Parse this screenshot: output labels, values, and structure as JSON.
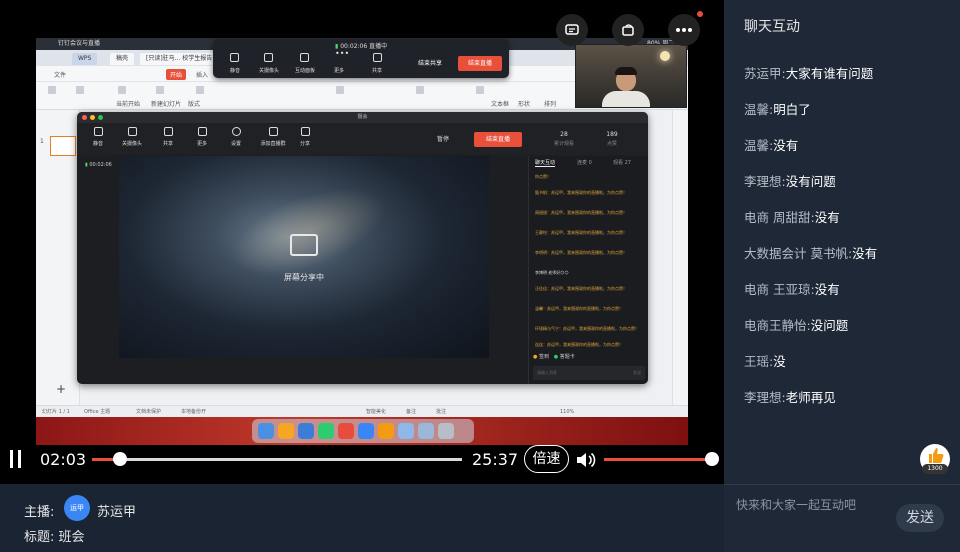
{
  "mac_menubar": {
    "app": "钉钉会议与直播",
    "right": "80%  周二 5"
  },
  "wps": {
    "tabs": [
      "WPS",
      "稿壳",
      "[只读]驻马... 校学生报告"
    ],
    "menu": [
      "文件",
      "开始",
      "插入"
    ],
    "ribbon_small": [
      "当前开始",
      "新建幻灯片",
      "版式",
      "文本框",
      "形状",
      "排列"
    ],
    "status_left": "幻灯片 1 / 1",
    "status_theme": "Office 主题",
    "status_protect": "文档未保护",
    "status_backup": "本地备份开",
    "status_right": [
      "智能美化",
      "备注",
      "批注",
      "110%"
    ],
    "slide_index": "1"
  },
  "meeting_toolbar": {
    "timer": "00:02:06",
    "timer_status": "直播中",
    "items": [
      "静音",
      "关摄像头",
      "互动面板",
      "更多",
      "共享"
    ],
    "end_share": "结束共享",
    "end_live": "结束直播"
  },
  "meeting_window": {
    "title": "摄会",
    "tools": [
      "静音",
      "关摄像头",
      "共享",
      "更多",
      "设置",
      "添加直播群",
      "分享"
    ],
    "pause": "暂停",
    "end_live": "结束直播",
    "stats": [
      {
        "value": "28",
        "label": "累计观看"
      },
      {
        "value": "189",
        "label": "点赞"
      }
    ],
    "timer": "00:02:06",
    "share_text": "屏幕分享中",
    "chat_tabs": [
      "聊天互动",
      "连麦 0",
      "观看 27"
    ],
    "chat_messages": [
      "你点赞！",
      "甄书帆：苏运甲，我来围观你的直播啦，为你点赞！",
      "周甜甜：苏运甲，我来围观你的直播啦，为你点赞！",
      "王静怡：苏运甲，我来围观你的直播啦，为你点赞！",
      "李明明：苏运甲，我来围观你的直播啦，为你点赞！",
      "李博明 老师好😊😊",
      "汪佳佳：苏运甲，我来围观你的直播啦，为你点赞！",
      "温馨：苏运甲，我来围观你的直播啦，为你点赞！",
      "环境精与气宁：苏运甲，我来围观你的直播啦，为你点赞！",
      "连连：苏运甲，我来围观你的直播啦，为你点赞！"
    ],
    "chat_footer": [
      "签到",
      "答题卡"
    ],
    "chat_placeholder": "请输入消息",
    "chat_send": "发送"
  },
  "player": {
    "current_time": "02:03",
    "total_time": "25:37",
    "progress": 0.075,
    "speed_label": "倍速",
    "volume": 1.0
  },
  "info": {
    "host_label": "主播:",
    "avatar_text": "运甲",
    "host_name": "苏运甲",
    "title_line": "标题: 班会"
  },
  "chat": {
    "title": "聊天互动",
    "messages": [
      {
        "user": "苏运甲:",
        "text": "大家有谁有问题"
      },
      {
        "user": "温馨:",
        "text": "明白了"
      },
      {
        "user": "温馨:",
        "text": "没有"
      },
      {
        "user": "李理想:",
        "text": "没有问题"
      },
      {
        "user": "电商 周甜甜:",
        "text": "没有"
      },
      {
        "user": "大数据会计 莫书帆:",
        "text": "没有"
      },
      {
        "user": "电商 王亚琼:",
        "text": "没有"
      },
      {
        "user": "电商王静怡:",
        "text": "没问题"
      },
      {
        "user": "王瑶:",
        "text": "没"
      },
      {
        "user": "李理想:",
        "text": "老师再见"
      }
    ],
    "like_count": "1300",
    "input_placeholder": "快来和大家一起互动吧",
    "send_label": "发送"
  },
  "colors": {
    "accent": "#e8503a",
    "panel": "#1e2837",
    "avatar": "#3b86f7",
    "live_green": "#4cd964"
  }
}
